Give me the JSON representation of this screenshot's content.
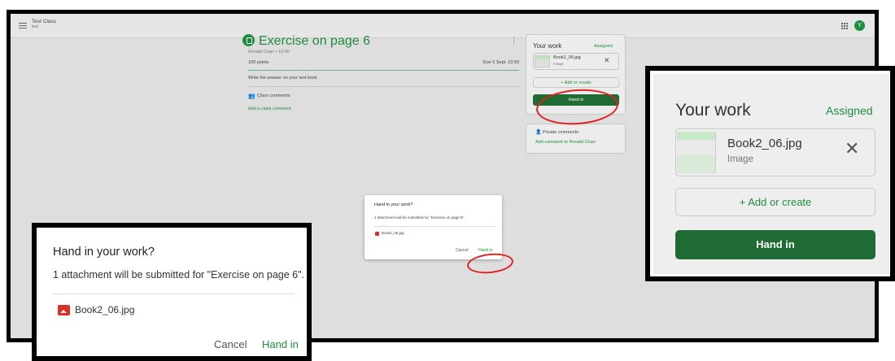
{
  "topbar": {
    "class_title": "Test Class",
    "class_subtitle": "test",
    "avatar_initial": "Y"
  },
  "assignment": {
    "title": "Exercise on page 6",
    "author_time": "Ronald Chan • 10:00",
    "points": "100 points",
    "due": "Due 5 Sept. 23:59",
    "instructions": "Write the answer on your text book",
    "class_comments_label": "Class comments",
    "add_class_comment": "Add a class comment"
  },
  "your_work": {
    "title": "Your work",
    "status": "Assigned",
    "attachment_name": "Book2_06.jpg",
    "attachment_type": "Image",
    "add_create": "+ Add or create",
    "hand_in": "Hand in"
  },
  "private_comments": {
    "label": "Private comments",
    "add": "Add comment to Ronald Chan"
  },
  "dialog": {
    "title": "Hand in your work?",
    "description": "1 attachment will be submitted for \"Exercise on page 6\".",
    "file": "Book2_06.jpg",
    "cancel": "Cancel",
    "hand_in": "Hand in"
  },
  "colors": {
    "accent": "#1e8e3e",
    "button": "#1e6b34",
    "annotation": "#e02020",
    "file_icon": "#d93025"
  }
}
